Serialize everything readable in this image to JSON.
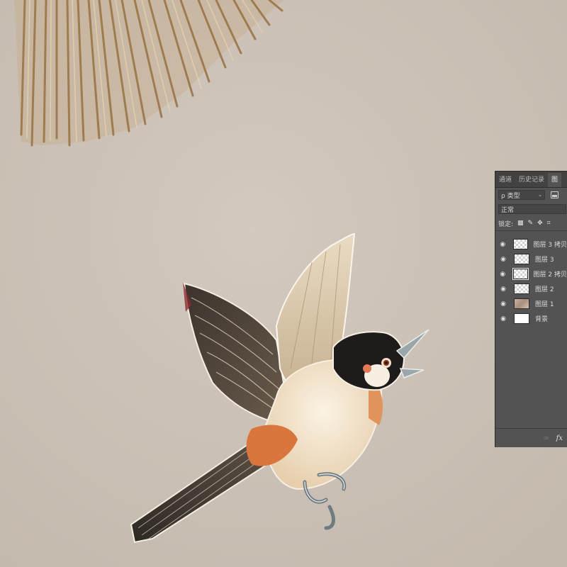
{
  "panel": {
    "tabs": [
      "通道",
      "历史记录",
      "图"
    ],
    "filter_label": "ρ 类型",
    "blend_mode": "正常",
    "lock_label": "锁定:",
    "layers": [
      {
        "name": "图层 3 拷贝",
        "visible": true,
        "thumb": "transparent"
      },
      {
        "name": "图层 3",
        "visible": true,
        "thumb": "transparent"
      },
      {
        "name": "图层 2 拷贝",
        "visible": true,
        "thumb": "transparent",
        "selected": true
      },
      {
        "name": "图层 2",
        "visible": true,
        "thumb": "transparent"
      },
      {
        "name": "图层 1",
        "visible": true,
        "thumb": "image"
      },
      {
        "name": "背景",
        "visible": true,
        "thumb": "white"
      }
    ],
    "bottom_icons": [
      "link-icon",
      "fx-icon"
    ],
    "bottom_link": "∞",
    "bottom_fx": "fx"
  },
  "icons": {
    "eye": "eye-icon",
    "lock": [
      "lock-transparent-icon",
      "brush-icon",
      "move-icon",
      "artboard-icon"
    ]
  },
  "colors": {
    "canvas_bg": "#cbc1b6",
    "panel_bg": "#535353",
    "panel_tabbar": "#424242"
  }
}
